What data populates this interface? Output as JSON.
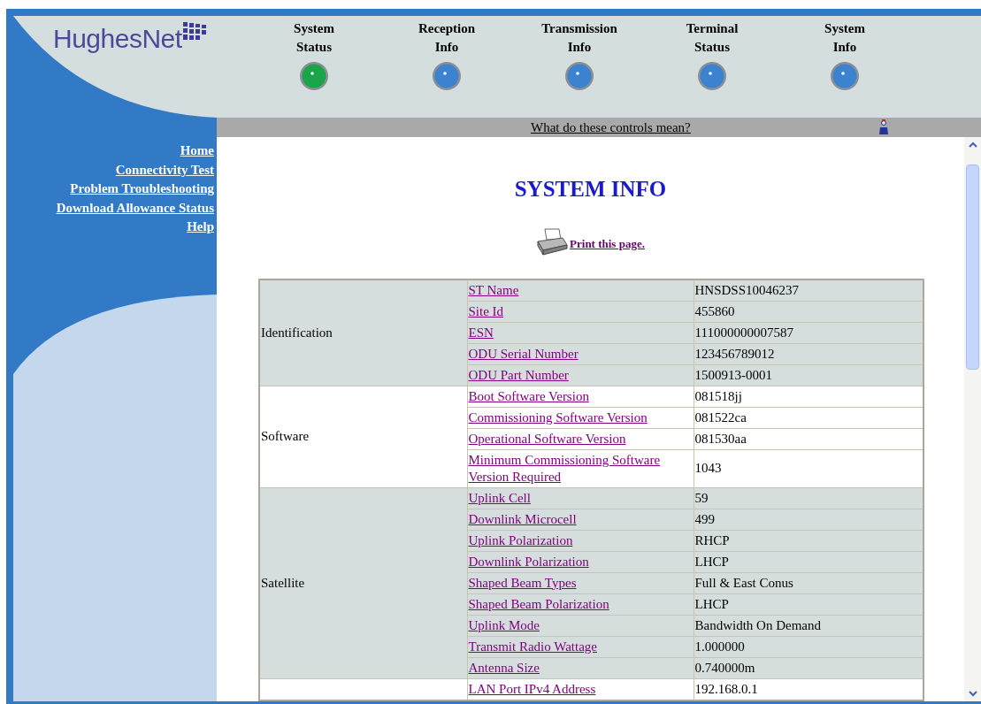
{
  "logo": {
    "text": "HughesNet"
  },
  "nav": [
    {
      "line1": "System",
      "line2": "Status",
      "color": "#1aa54a"
    },
    {
      "line1": "Reception",
      "line2": "Info",
      "color": "#3b82d0"
    },
    {
      "line1": "Transmission",
      "line2": "Info",
      "color": "#3b82d0"
    },
    {
      "line1": "Terminal",
      "line2": "Status",
      "color": "#3b82d0"
    },
    {
      "line1": "System",
      "line2": "Info",
      "color": "#3b82d0"
    }
  ],
  "help_bar": {
    "link": "What do these controls mean?"
  },
  "sidebar": {
    "items": [
      "Home",
      "Connectivity Test",
      "Problem Troubleshooting",
      "Download Allowance Status",
      "Help"
    ]
  },
  "page_title": "SYSTEM INFO",
  "print_link": "Print this page.",
  "table": {
    "groups": [
      {
        "label": "Identification",
        "rows": [
          {
            "field": "ST Name",
            "value": "HNSDSS10046237"
          },
          {
            "field": "Site Id",
            "value": "455860"
          },
          {
            "field": "ESN",
            "value": "111000000007587"
          },
          {
            "field": "ODU Serial Number",
            "value": "123456789012"
          },
          {
            "field": "ODU Part Number",
            "value": "1500913-0001"
          }
        ]
      },
      {
        "label": "Software",
        "rows": [
          {
            "field": "Boot Software Version",
            "value": "081518jj"
          },
          {
            "field": "Commissioning Software Version",
            "value": "081522ca"
          },
          {
            "field": "Operational Software Version",
            "value": "081530aa"
          },
          {
            "field": "Minimum Commissioning Software Version Required",
            "value": "1043"
          }
        ]
      },
      {
        "label": "Satellite",
        "rows": [
          {
            "field": "Uplink Cell",
            "value": "59"
          },
          {
            "field": "Downlink Microcell",
            "value": "499"
          },
          {
            "field": "Uplink Polarization",
            "value": "RHCP"
          },
          {
            "field": "Downlink Polarization",
            "value": "LHCP"
          },
          {
            "field": "Shaped Beam Types",
            "value": "Full & East Conus"
          },
          {
            "field": "Shaped Beam Polarization",
            "value": "LHCP"
          },
          {
            "field": "Uplink Mode",
            "value": "Bandwidth On Demand"
          },
          {
            "field": "Transmit Radio Wattage",
            "value": "1.000000"
          },
          {
            "field": "Antenna Size",
            "value": "0.740000m"
          }
        ]
      },
      {
        "rows": [
          {
            "field": "LAN Port IPv4 Address",
            "value": "192.168.0.1"
          }
        ]
      }
    ]
  }
}
